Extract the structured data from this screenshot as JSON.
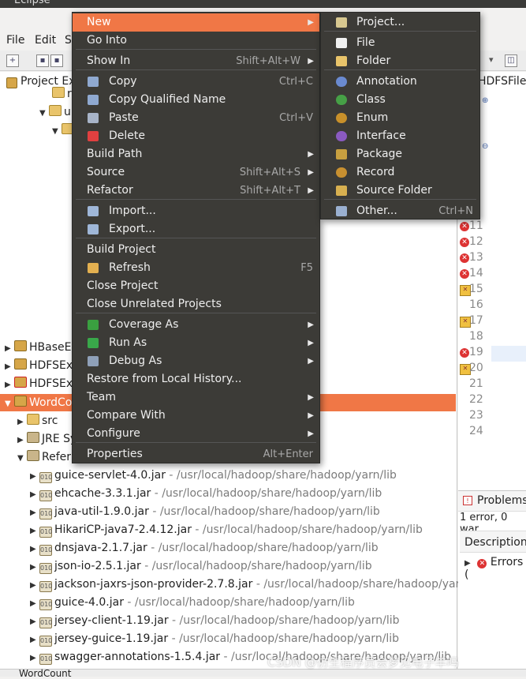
{
  "window": {
    "title": "Eclipse"
  },
  "menubar": {
    "items": [
      "File",
      "Edit",
      "S"
    ]
  },
  "explorer": {
    "tab": "Project Ex",
    "projects": [
      {
        "label": "HBaseEx",
        "status": ""
      },
      {
        "label": "HDFSEx",
        "status": ""
      },
      {
        "label": "HDFSEx",
        "status": "error"
      },
      {
        "label": "WordCo",
        "status": "selected"
      }
    ],
    "children": [
      "src",
      "JRE Sy",
      "Refer"
    ],
    "jars": [
      {
        "name": "guice-servlet-4.0.jar",
        "path": " - /usr/local/hadoop/share/hadoop/yarn/lib"
      },
      {
        "name": "ehcache-3.3.1.jar",
        "path": " - /usr/local/hadoop/share/hadoop/yarn/lib"
      },
      {
        "name": "java-util-1.9.0.jar",
        "path": " - /usr/local/hadoop/share/hadoop/yarn/lib"
      },
      {
        "name": "HikariCP-java7-2.4.12.jar",
        "path": " - /usr/local/hadoop/share/hadoop/yarn/lib"
      },
      {
        "name": "dnsjava-2.1.7.jar",
        "path": " - /usr/local/hadoop/share/hadoop/yarn/lib"
      },
      {
        "name": "json-io-2.5.1.jar",
        "path": " - /usr/local/hadoop/share/hadoop/yarn/lib"
      },
      {
        "name": "jackson-jaxrs-json-provider-2.7.8.jar",
        "path": " - /usr/local/hadoop/share/hadoop/yarn"
      },
      {
        "name": "guice-4.0.jar",
        "path": " - /usr/local/hadoop/share/hadoop/yarn/lib"
      },
      {
        "name": "jersey-client-1.19.jar",
        "path": " - /usr/local/hadoop/share/hadoop/yarn/lib"
      },
      {
        "name": "jersey-guice-1.19.jar",
        "path": " - /usr/local/hadoop/share/hadoop/yarn/lib"
      },
      {
        "name": "swagger-annotations-1.5.4.jar",
        "path": " - /usr/local/hadoop/share/hadoop/yarn/lib"
      }
    ],
    "tree_fragments": [
      "ri",
      "u"
    ]
  },
  "editor": {
    "tab": "HDFSFile",
    "lines": [
      {
        "n": "11",
        "mark": "error"
      },
      {
        "n": "12",
        "mark": "error"
      },
      {
        "n": "13",
        "mark": "error"
      },
      {
        "n": "14",
        "mark": "error"
      },
      {
        "n": "15",
        "mark": "warning"
      },
      {
        "n": "16",
        "mark": ""
      },
      {
        "n": "17",
        "mark": "warning"
      },
      {
        "n": "18",
        "mark": ""
      },
      {
        "n": "19",
        "mark": "error"
      },
      {
        "n": "20",
        "mark": "warning"
      },
      {
        "n": "21",
        "mark": ""
      },
      {
        "n": "22",
        "mark": ""
      },
      {
        "n": "23",
        "mark": ""
      },
      {
        "n": "24",
        "mark": ""
      }
    ]
  },
  "problems": {
    "tab": "Problems",
    "summary": "1 error, 0 war",
    "column": "Description",
    "group": "Errors ("
  },
  "bottombar": {
    "label": "WordCount"
  },
  "watermark": "CSDN @仿生程序员会梦见电子羊吗",
  "context_menu": {
    "items": [
      {
        "label": "New",
        "shortcut": "",
        "submenu": true,
        "icon": "",
        "highlighted": true
      },
      {
        "label": "Go Into",
        "shortcut": "",
        "submenu": false,
        "icon": ""
      },
      {
        "label": "Show In",
        "shortcut": "Shift+Alt+W",
        "submenu": true,
        "icon": ""
      },
      {
        "label": "Copy",
        "shortcut": "Ctrl+C",
        "submenu": false,
        "icon": "copy-icon"
      },
      {
        "label": "Copy Qualified Name",
        "shortcut": "",
        "submenu": false,
        "icon": "copy-icon"
      },
      {
        "label": "Paste",
        "shortcut": "Ctrl+V",
        "submenu": false,
        "icon": "paste-icon"
      },
      {
        "label": "Delete",
        "shortcut": "",
        "submenu": false,
        "icon": "delete-icon"
      },
      {
        "label": "Build Path",
        "shortcut": "",
        "submenu": true,
        "icon": ""
      },
      {
        "label": "Source",
        "shortcut": "Shift+Alt+S",
        "submenu": true,
        "icon": ""
      },
      {
        "label": "Refactor",
        "shortcut": "Shift+Alt+T",
        "submenu": true,
        "icon": ""
      },
      {
        "label": "Import...",
        "shortcut": "",
        "submenu": false,
        "icon": "import-icon"
      },
      {
        "label": "Export...",
        "shortcut": "",
        "submenu": false,
        "icon": "export-icon"
      },
      {
        "label": "Build Project",
        "shortcut": "",
        "submenu": false,
        "icon": ""
      },
      {
        "label": "Refresh",
        "shortcut": "F5",
        "submenu": false,
        "icon": "refresh-icon"
      },
      {
        "label": "Close Project",
        "shortcut": "",
        "submenu": false,
        "icon": ""
      },
      {
        "label": "Close Unrelated Projects",
        "shortcut": "",
        "submenu": false,
        "icon": ""
      },
      {
        "label": "Coverage As",
        "shortcut": "",
        "submenu": true,
        "icon": "coverage-icon"
      },
      {
        "label": "Run As",
        "shortcut": "",
        "submenu": true,
        "icon": "run-icon"
      },
      {
        "label": "Debug As",
        "shortcut": "",
        "submenu": true,
        "icon": "debug-icon"
      },
      {
        "label": "Restore from Local History...",
        "shortcut": "",
        "submenu": false,
        "icon": ""
      },
      {
        "label": "Team",
        "shortcut": "",
        "submenu": true,
        "icon": ""
      },
      {
        "label": "Compare With",
        "shortcut": "",
        "submenu": true,
        "icon": ""
      },
      {
        "label": "Configure",
        "shortcut": "",
        "submenu": true,
        "icon": ""
      },
      {
        "label": "Properties",
        "shortcut": "Alt+Enter",
        "submenu": false,
        "icon": ""
      }
    ]
  },
  "new_submenu": {
    "items": [
      {
        "label": "Project...",
        "shortcut": "",
        "icon": "project-icon"
      },
      {
        "label": "File",
        "shortcut": "",
        "icon": "file-icon"
      },
      {
        "label": "Folder",
        "shortcut": "",
        "icon": "folder-icon"
      },
      {
        "label": "Annotation",
        "shortcut": "",
        "icon": "annotation-icon"
      },
      {
        "label": "Class",
        "shortcut": "",
        "icon": "class-icon"
      },
      {
        "label": "Enum",
        "shortcut": "",
        "icon": "enum-icon"
      },
      {
        "label": "Interface",
        "shortcut": "",
        "icon": "interface-icon"
      },
      {
        "label": "Package",
        "shortcut": "",
        "icon": "package-icon"
      },
      {
        "label": "Record",
        "shortcut": "",
        "icon": "record-icon"
      },
      {
        "label": "Source Folder",
        "shortcut": "",
        "icon": "source-folder-icon"
      },
      {
        "label": "Other...",
        "shortcut": "Ctrl+N",
        "icon": "other-icon"
      }
    ]
  },
  "colors": {
    "accent": "#f07746",
    "menu_bg": "#3c3b37",
    "menu_text": "#eeeeee",
    "shortcut_text": "#a9a9a9",
    "error": "#dd3333"
  }
}
